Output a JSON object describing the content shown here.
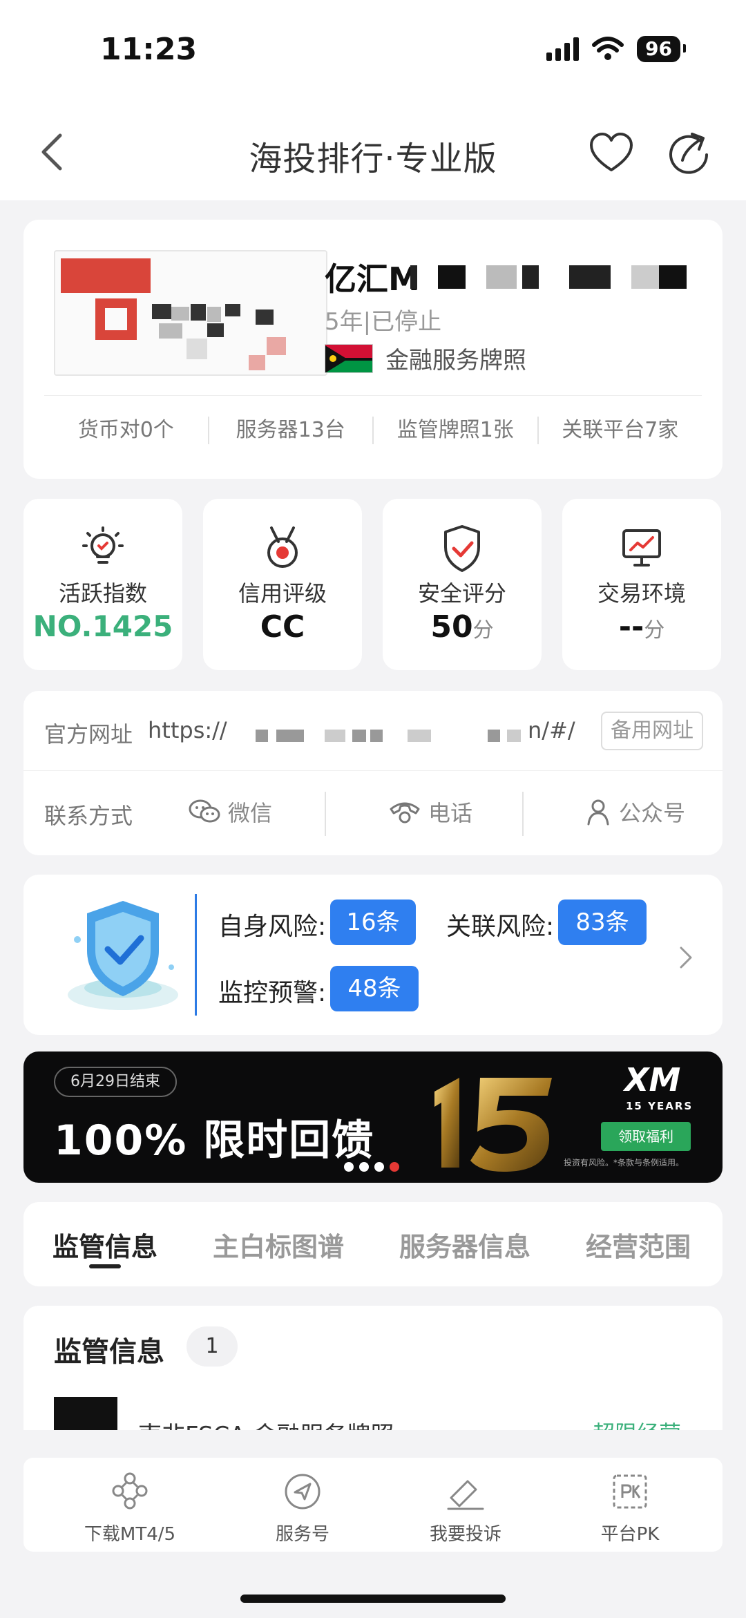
{
  "status": {
    "time": "11:23",
    "battery": "96"
  },
  "nav": {
    "title": "海投排行·专业版"
  },
  "broker": {
    "name": "亿汇M",
    "meta": "5年|已停止",
    "license": "金融服务牌照",
    "stats": [
      "货币对0个",
      "服务器13台",
      "监管牌照1张",
      "关联平台7家"
    ]
  },
  "metrics": [
    {
      "label": "活跃指数",
      "value": "NO.1425",
      "unit": ""
    },
    {
      "label": "信用评级",
      "value": "CC",
      "unit": ""
    },
    {
      "label": "安全评分",
      "value": "50",
      "unit": "分"
    },
    {
      "label": "交易环境",
      "value": "--",
      "unit": "分"
    }
  ],
  "info": {
    "url_label": "官方网址",
    "url_prefix": "https://",
    "url_suffix": "n/#/",
    "backup": "备用网址",
    "contact_label": "联系方式",
    "contacts": [
      "微信",
      "电话",
      "公众号"
    ]
  },
  "risk": {
    "self_label": "自身风险:",
    "self_count": "16条",
    "related_label": "关联风险:",
    "related_count": "83条",
    "monitor_label": "监控预警:",
    "monitor_count": "48条"
  },
  "banner": {
    "pill": "6月29日结束",
    "headline": "100% 限时回馈",
    "brand": "XM",
    "years": "15 YEARS",
    "cta": "领取福利",
    "disclaimer": "投资有风险。*条款与条例适用。"
  },
  "tabs": [
    "监管信息",
    "主白标图谱",
    "服务器信息",
    "经营范围"
  ],
  "section": {
    "title": "监管信息",
    "count": "1",
    "row_text": "南非FSCA  金融服务牌照",
    "row_status": "超限经营"
  },
  "bottom": [
    "下载MT4/5",
    "服务号",
    "我要投诉",
    "平台PK"
  ],
  "colors": {
    "accent_blue": "#2f7ff0",
    "green": "#3bb07b",
    "banner_cta": "#2aa65a"
  }
}
